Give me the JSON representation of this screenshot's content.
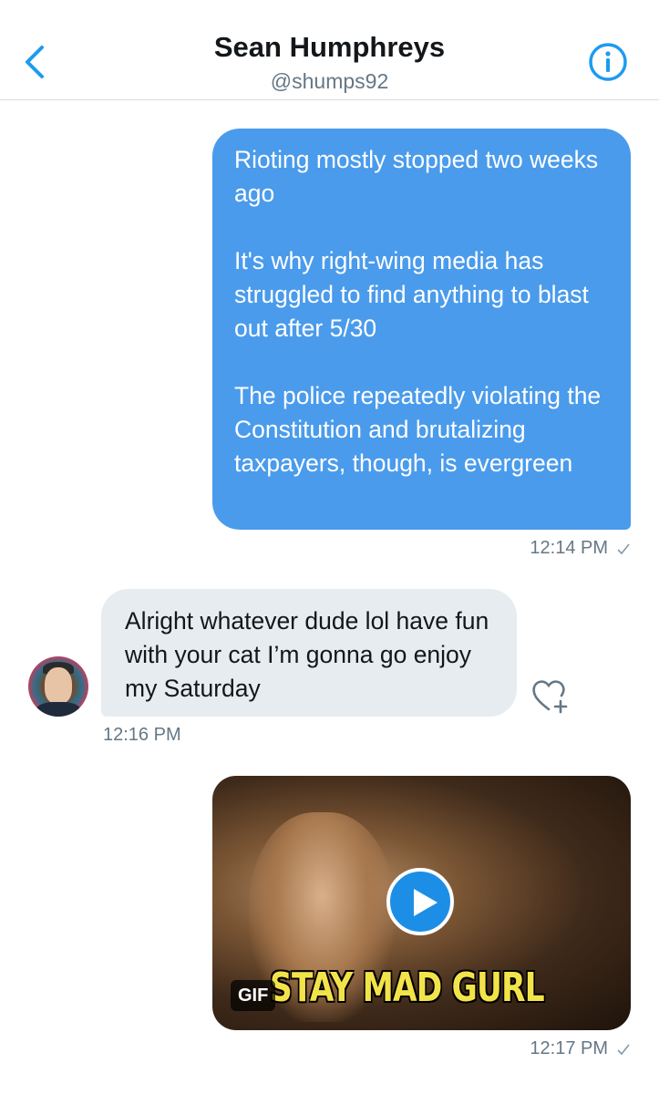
{
  "header": {
    "title": "Sean Humphreys",
    "handle": "@shumps92",
    "back_icon": "chevron-left-icon",
    "info_icon": "info-circle-icon"
  },
  "colors": {
    "accent": "#1d9bf0",
    "outgoing_bubble": "#4a9beb",
    "incoming_bubble": "#e6ecf0",
    "meta_text": "#657786"
  },
  "messages": [
    {
      "direction": "outgoing",
      "paragraphs": [
        "Rioting mostly stopped two weeks ago",
        "It's why right-wing media has struggled to find anything to blast out after 5/30",
        "The police repeatedly violating the Constitution and brutalizing taxpayers, though, is evergreen"
      ],
      "time": "12:14 PM"
    },
    {
      "direction": "incoming",
      "text": "Alright whatever dude lol have fun with your cat I’m gonna go enjoy my Saturday",
      "time": "12:16 PM"
    },
    {
      "direction": "outgoing",
      "type": "gif",
      "caption": "STAY MAD GURL",
      "badge": "GIF",
      "time": "12:17 PM"
    }
  ]
}
